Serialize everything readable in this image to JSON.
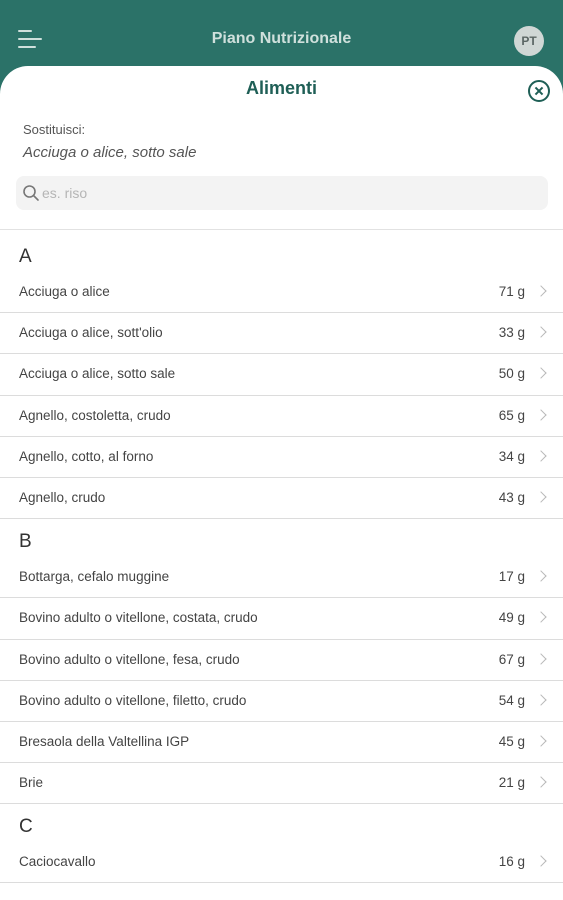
{
  "header": {
    "title": "Piano Nutrizionale",
    "avatar_initials": "PT"
  },
  "sheet": {
    "title": "Alimenti",
    "replace_label": "Sostituisci:",
    "replace_value": "Acciuga o alice, sotto sale",
    "search_placeholder": "es. riso"
  },
  "sections": [
    {
      "letter": "A",
      "items": [
        {
          "name": "Acciuga o alice",
          "qty": "71 g"
        },
        {
          "name": "Acciuga o alice, sott'olio",
          "qty": "33 g"
        },
        {
          "name": "Acciuga o alice, sotto sale",
          "qty": "50 g"
        },
        {
          "name": "Agnello, costoletta, crudo",
          "qty": "65 g"
        },
        {
          "name": "Agnello, cotto, al forno",
          "qty": "34 g"
        },
        {
          "name": "Agnello, crudo",
          "qty": "43 g"
        }
      ]
    },
    {
      "letter": "B",
      "items": [
        {
          "name": "Bottarga, cefalo muggine",
          "qty": "17 g"
        },
        {
          "name": "Bovino adulto o vitellone, costata, crudo",
          "qty": "49 g"
        },
        {
          "name": "Bovino adulto o vitellone, fesa, crudo",
          "qty": "67 g"
        },
        {
          "name": "Bovino adulto o vitellone, filetto, crudo",
          "qty": "54 g"
        },
        {
          "name": "Bresaola della Valtellina IGP",
          "qty": "45 g"
        },
        {
          "name": "Brie",
          "qty": "21 g"
        }
      ]
    },
    {
      "letter": "C",
      "items": [
        {
          "name": "Caciocavallo",
          "qty": "16 g"
        }
      ]
    }
  ]
}
